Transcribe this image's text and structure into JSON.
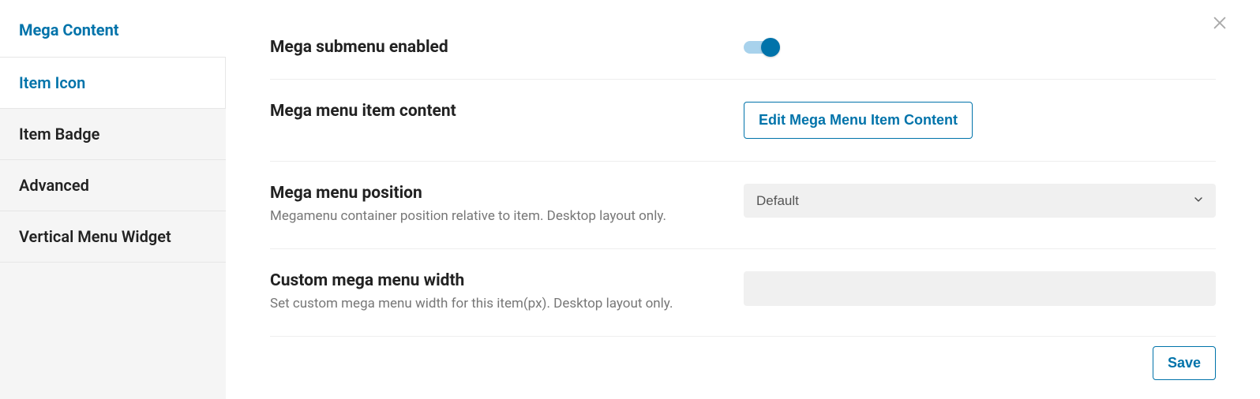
{
  "sidebar": {
    "title": "Mega Content",
    "items": [
      {
        "label": "Item Icon",
        "active": true
      },
      {
        "label": "Item Badge",
        "active": false
      },
      {
        "label": "Advanced",
        "active": false
      },
      {
        "label": "Vertical Menu Widget",
        "active": false
      }
    ]
  },
  "fields": {
    "submenu_enabled": {
      "label": "Mega submenu enabled",
      "value": true
    },
    "item_content": {
      "label": "Mega menu item content",
      "button_label": "Edit Mega Menu Item Content"
    },
    "position": {
      "label": "Mega menu position",
      "description": "Megamenu container position relative to item. Desktop layout only.",
      "selected": "Default"
    },
    "custom_width": {
      "label": "Custom mega menu width",
      "description": "Set custom mega menu width for this item(px). Desktop layout only.",
      "value": ""
    }
  },
  "footer": {
    "save_label": "Save"
  },
  "colors": {
    "accent": "#0073aa"
  }
}
